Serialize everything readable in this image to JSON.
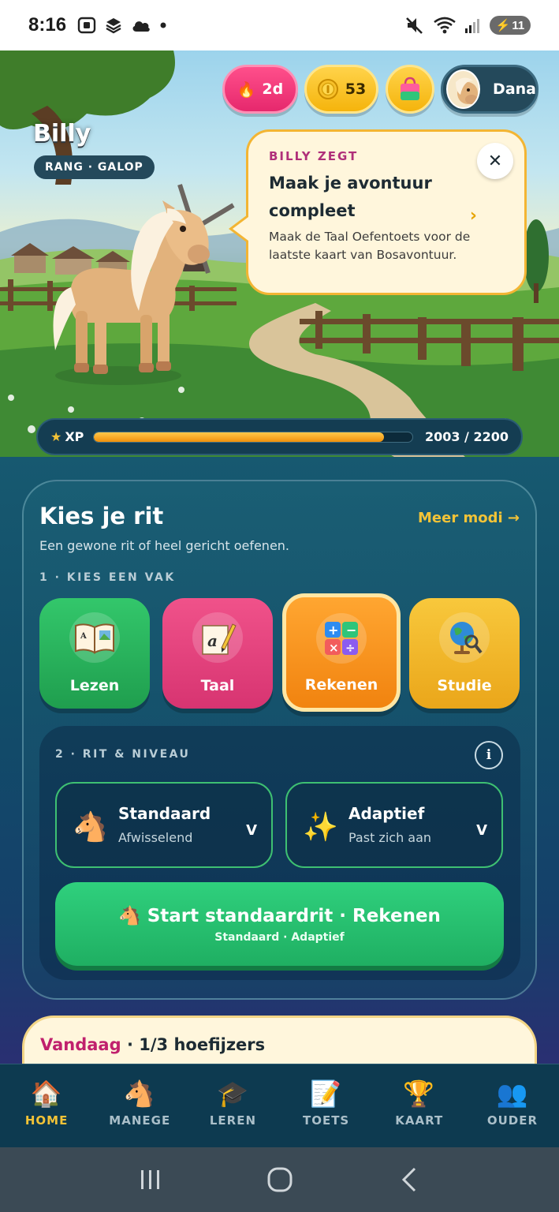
{
  "status_bar": {
    "time": "8:16",
    "battery": "11"
  },
  "hero": {
    "pet_name": "Billy",
    "rank": "RANG · GALOP",
    "streak": "2d",
    "coins": "53",
    "profile_name": "Dana",
    "speech": {
      "eyebrow": "BILLY ZEGT",
      "title": "Maak je avontuur compleet",
      "body": "Maak de Taal Oefentoets voor de laatste kaart van Bosavontuur."
    },
    "xp": {
      "label": "XP",
      "value_text": "2003 / 2200",
      "current": 2003,
      "max": 2200
    }
  },
  "ride": {
    "title": "Kies je rit",
    "more_modes": "Meer modi →",
    "subtitle": "Een gewone rit of heel gericht oefenen.",
    "step1_label": "1 · KIES EEN VAK",
    "subjects": [
      {
        "label": "Lezen",
        "icon": "book-icon"
      },
      {
        "label": "Taal",
        "icon": "pencil-paper-icon"
      },
      {
        "label": "Rekenen",
        "icon": "calculator-icon",
        "selected": true
      },
      {
        "label": "Studie",
        "icon": "globe-icon"
      }
    ],
    "step2_label": "2 · RIT & NIVEAU",
    "ride_type": {
      "title": "Standaard",
      "sub": "Afwisselend"
    },
    "level": {
      "title": "Adaptief",
      "sub": "Past zich aan"
    },
    "start_title": "Start standaardrit · Rekenen",
    "start_sub": "Standaard · Adaptief"
  },
  "today": {
    "accent": "Vandaag",
    "rest": " · 1/3 hoefijzers"
  },
  "nav": [
    {
      "label": "HOME",
      "icon": "home-icon",
      "active": true
    },
    {
      "label": "MANEGE",
      "icon": "horse-icon"
    },
    {
      "label": "LEREN",
      "icon": "graduation-cap-icon"
    },
    {
      "label": "TOETS",
      "icon": "memo-icon"
    },
    {
      "label": "KAART",
      "icon": "trophy-icon"
    },
    {
      "label": "OUDER",
      "icon": "parents-icon"
    }
  ],
  "colors": {
    "accent_gold": "#f2c337",
    "accent_green": "#1faf62",
    "accent_pink": "#e6286d"
  }
}
